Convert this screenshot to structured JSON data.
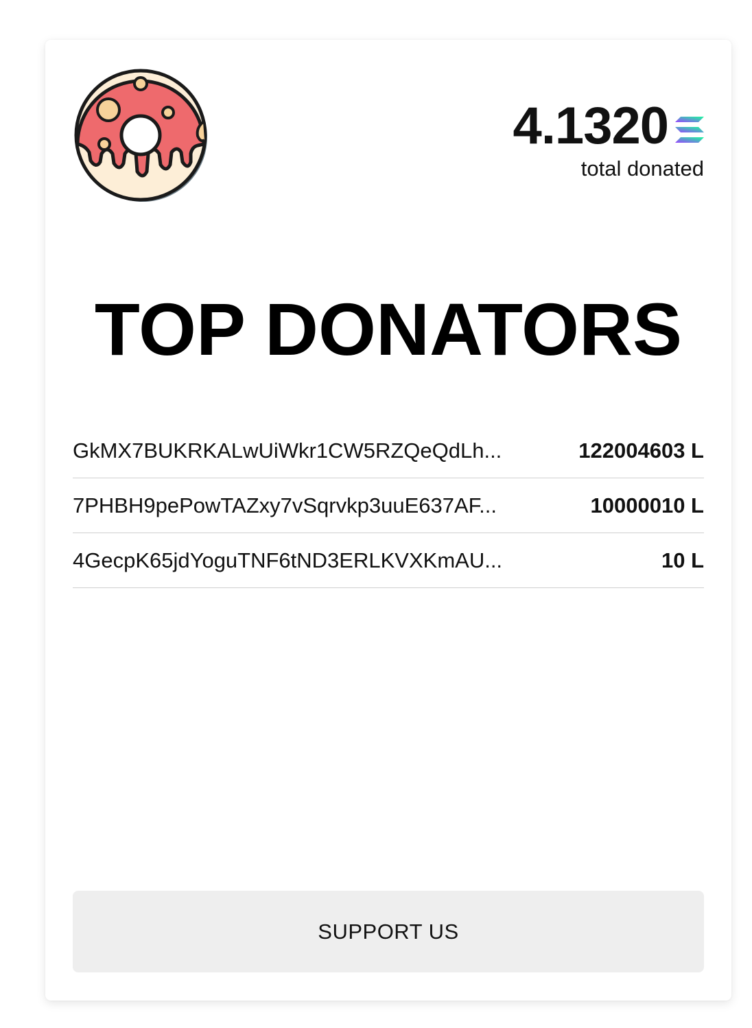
{
  "logo": {
    "icon": "donut-icon",
    "colors": {
      "frosting": "#ee6a6d",
      "dough": "#fdeed7",
      "sprinkle": "#f7d29a",
      "outline": "#1a1a1a"
    }
  },
  "total": {
    "amount": "4.1320",
    "label": "total donated",
    "currency_icon": "solana-icon"
  },
  "heading": "TOP DONATORS",
  "donors": [
    {
      "address": "GkMX7BUKRKALwUiWkr1CW5RZQeQdLh...",
      "amount": "122004603 L"
    },
    {
      "address": "7PHBH9pePowTAZxy7vSqrvkp3uuE637AF...",
      "amount": "10000010 L"
    },
    {
      "address": "4GecpK65jdYoguTNF6tND3ERLKVXKmAU...",
      "amount": "10 L"
    }
  ],
  "support_button": {
    "label": "SUPPORT US"
  }
}
